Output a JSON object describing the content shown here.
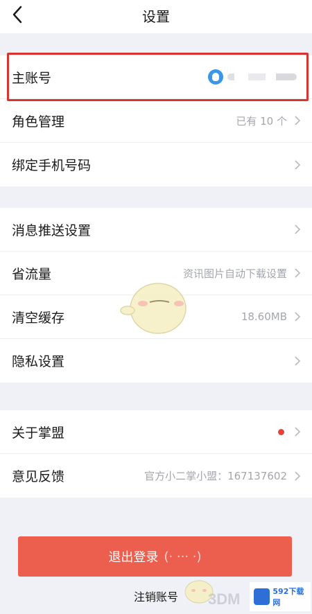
{
  "header": {
    "title": "设置",
    "back_icon": "chevron-left-icon"
  },
  "group1": {
    "main_account": {
      "label": "主账号",
      "value_masked": "1··· ··· ·· ·",
      "icon": "qq-avatar-icon"
    },
    "roles": {
      "label": "角色管理",
      "value": "已有 10 个"
    },
    "bind_phone": {
      "label": "绑定手机号码"
    }
  },
  "group2": {
    "push": {
      "label": "消息推送设置"
    },
    "data_saver": {
      "label": "省流量",
      "value": "资讯图片自动下载设置"
    },
    "cache": {
      "label": "清空缓存",
      "value": "18.60MB"
    },
    "privacy": {
      "label": "隐私设置"
    }
  },
  "group3": {
    "about": {
      "label": "关于掌盟"
    },
    "feedback": {
      "label": "意见反馈",
      "value": "官方小二掌小盟：167137602"
    }
  },
  "logout_label": "退出登录",
  "cancel_account_label": "注销账号",
  "watermarks": {
    "site": "592下载网",
    "brand": "3DM"
  },
  "colors": {
    "accent_red": "#ec5e4d",
    "highlight_border": "#d9332f",
    "dot": "#e0443e"
  }
}
